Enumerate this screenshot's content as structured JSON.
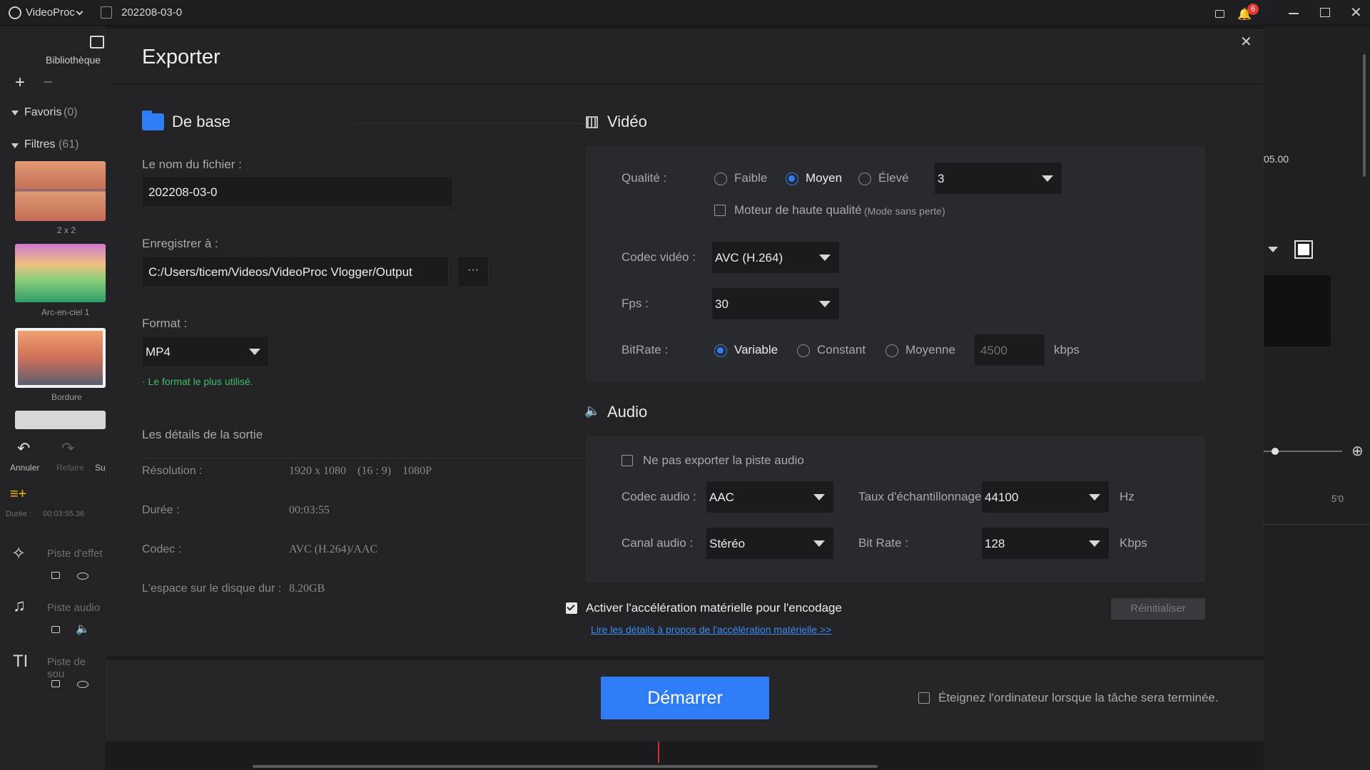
{
  "app": {
    "name": "VideoProc",
    "project": "202208-03-0",
    "notif_count": "6"
  },
  "sidebar": {
    "library_label": "Bibliothèque",
    "favorites_label": "Favoris",
    "favorites_count": "(0)",
    "filters_label": "Filtres",
    "filters_count": "(61)",
    "thumbs": [
      "2 x 2",
      "Arc-en-ciel 1",
      "Bordure"
    ],
    "undo": "Annuler",
    "redo": "Refaire",
    "su": "Su",
    "duration_label": "Durée :",
    "duration_value": "00:03:55.36",
    "tracks": [
      "Piste d'effet",
      "Piste audio",
      "Piste de sou"
    ]
  },
  "right_bg": {
    "time": "05.00",
    "scale_mark": "5'0"
  },
  "dialog": {
    "title": "Exporter",
    "basic": {
      "title": "De base",
      "filename_label": "Le nom du fichier :",
      "filename_value": "202208-03-0",
      "save_label": "Enregistrer à :",
      "save_path": "C:/Users/ticem/Videos/VideoProc Vlogger/Output",
      "browse": "···",
      "format_label": "Format :",
      "format_value": "MP4",
      "format_hint": "· Le format le plus utilisé.",
      "details_title": "Les détails de la sortie",
      "resolution_label": "Résolution :",
      "resolution_value": "1920 x 1080    (16 : 9)    1080P",
      "duration_label": "Durée :",
      "duration_value": "00:03:55",
      "codec_label": "Codec :",
      "codec_value": "AVC (H.264)/AAC",
      "disk_label": "L'espace sur le disque dur :",
      "disk_value": "8.20GB"
    },
    "video": {
      "title": "Vidéo",
      "quality_label": "Qualité :",
      "quality_low": "Faible",
      "quality_mid": "Moyen",
      "quality_high": "Élevé",
      "quality_value": "3",
      "hq_engine": "Moteur de haute qualité",
      "hq_engine_note": "(Mode sans perte)",
      "codec_label": "Codec vidéo :",
      "codec_value": "AVC (H.264)",
      "fps_label": "Fps :",
      "fps_value": "30",
      "bitrate_label": "BitRate :",
      "bitrate_variable": "Variable",
      "bitrate_constant": "Constant",
      "bitrate_average": "Moyenne",
      "bitrate_value": "4500",
      "bitrate_unit": "kbps"
    },
    "audio": {
      "title": "Audio",
      "no_export": "Ne pas exporter la piste audio",
      "codec_label": "Codec audio :",
      "codec_value": "AAC",
      "rate_label": "Taux d'échantillonnage :",
      "rate_value": "44100",
      "rate_unit": "Hz",
      "channel_label": "Canal audio :",
      "channel_value": "Stéréo",
      "bitrate_label": "Bit Rate :",
      "bitrate_value": "128",
      "bitrate_unit": "Kbps"
    },
    "hw_accel": "Activer l'accélération matérielle pour l'encodage",
    "hw_link": "Lire les détails à propos de l'accélération matérielle >>",
    "reset": "Réinitialiser",
    "start": "Démarrer",
    "shutdown": "Éteignez l'ordinateur lorsque la tâche sera terminée."
  },
  "colors": {
    "accent": "#2f7df6",
    "hint_green": "#3fbf6a",
    "link_blue": "#3d8cf0",
    "badge_red": "#e53935"
  }
}
